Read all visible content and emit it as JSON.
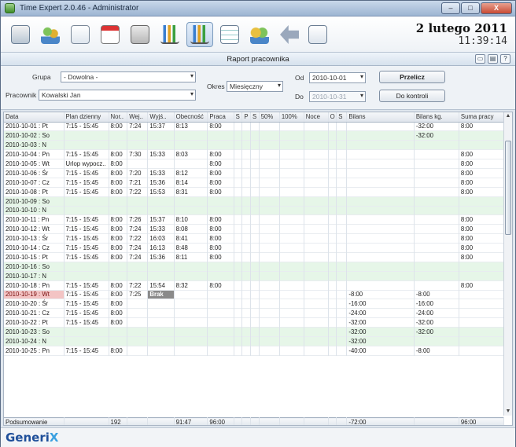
{
  "window": {
    "title": "Time Expert 2.0.46 - Administrator",
    "minimize": "–",
    "maximize": "□",
    "close": "X"
  },
  "clock": {
    "date": "2 lutego 2011",
    "time": "11:39:14"
  },
  "report": {
    "title": "Raport pracownika"
  },
  "filters": {
    "group_label": "Grupa",
    "group_value": "- Dowolna -",
    "employee_label": "Pracownik",
    "employee_value": "Kowalski Jan",
    "period_label": "Okres",
    "period_value": "Miesięczny",
    "from_label": "Od",
    "from_value": "2010-10-01",
    "to_label": "Do",
    "to_value": "2010-10-31",
    "show_button": "Przelicz",
    "contacts_button": "Do kontroli"
  },
  "table": {
    "columns": [
      "Data",
      "Plan dzienny",
      "Nor..",
      "Wej..",
      "Wyjś..",
      "Obecność",
      "Praca",
      "S",
      "P",
      "S",
      "50%",
      "100%",
      "Noce",
      "O",
      "S",
      "Bilans",
      "Bilans kg.",
      "Suma pracy"
    ],
    "rows": [
      {
        "c": [
          "2010-10-01 : Pt",
          "7:15 - 15:45",
          "8:00",
          "7:24",
          "15:37",
          "8:13",
          "8:00",
          "",
          "",
          "",
          "",
          "",
          "",
          "",
          "",
          "",
          "-32:00",
          "8:00"
        ],
        "t": ""
      },
      {
        "c": [
          "2010-10-02 : So",
          "",
          "",
          "",
          "",
          "",
          "",
          "",
          "",
          "",
          "",
          "",
          "",
          "",
          "",
          "",
          "-32:00",
          ""
        ],
        "t": "weekend"
      },
      {
        "c": [
          "2010-10-03 : N",
          "",
          "",
          "",
          "",
          "",
          "",
          "",
          "",
          "",
          "",
          "",
          "",
          "",
          "",
          "",
          "",
          ""
        ],
        "t": "weekend"
      },
      {
        "c": [
          "2010-10-04 : Pn",
          "7:15 - 15:45",
          "8:00",
          "7:30",
          "15:33",
          "8:03",
          "8:00",
          "",
          "",
          "",
          "",
          "",
          "",
          "",
          "",
          "",
          "",
          "8:00"
        ],
        "t": ""
      },
      {
        "c": [
          "2010-10-05 : Wt",
          "Urlop wypocz..",
          "8:00",
          "",
          "",
          "",
          "8:00",
          "",
          "",
          "",
          "",
          "",
          "",
          "",
          "",
          "",
          "",
          "8:00"
        ],
        "t": ""
      },
      {
        "c": [
          "2010-10-06 : Śr",
          "7:15 - 15:45",
          "8:00",
          "7:20",
          "15:33",
          "8:12",
          "8:00",
          "",
          "",
          "",
          "",
          "",
          "",
          "",
          "",
          "",
          "",
          "8:00"
        ],
        "t": ""
      },
      {
        "c": [
          "2010-10-07 : Cz",
          "7:15 - 15:45",
          "8:00",
          "7:21",
          "15:36",
          "8:14",
          "8:00",
          "",
          "",
          "",
          "",
          "",
          "",
          "",
          "",
          "",
          "",
          "8:00"
        ],
        "t": ""
      },
      {
        "c": [
          "2010-10-08 : Pt",
          "7:15 - 15:45",
          "8:00",
          "7:22",
          "15:53",
          "8:31",
          "8:00",
          "",
          "",
          "",
          "",
          "",
          "",
          "",
          "",
          "",
          "",
          "8:00"
        ],
        "t": ""
      },
      {
        "c": [
          "2010-10-09 : So",
          "",
          "",
          "",
          "",
          "",
          "",
          "",
          "",
          "",
          "",
          "",
          "",
          "",
          "",
          "",
          "",
          ""
        ],
        "t": "weekend"
      },
      {
        "c": [
          "2010-10-10 : N",
          "",
          "",
          "",
          "",
          "",
          "",
          "",
          "",
          "",
          "",
          "",
          "",
          "",
          "",
          "",
          "",
          ""
        ],
        "t": "weekend"
      },
      {
        "c": [
          "2010-10-11 : Pn",
          "7:15 - 15:45",
          "8:00",
          "7:26",
          "15:37",
          "8:10",
          "8:00",
          "",
          "",
          "",
          "",
          "",
          "",
          "",
          "",
          "",
          "",
          "8:00"
        ],
        "t": ""
      },
      {
        "c": [
          "2010-10-12 : Wt",
          "7:15 - 15:45",
          "8:00",
          "7:24",
          "15:33",
          "8:08",
          "8:00",
          "",
          "",
          "",
          "",
          "",
          "",
          "",
          "",
          "",
          "",
          "8:00"
        ],
        "t": ""
      },
      {
        "c": [
          "2010-10-13 : Śr",
          "7:15 - 15:45",
          "8:00",
          "7:22",
          "16:03",
          "8:41",
          "8:00",
          "",
          "",
          "",
          "",
          "",
          "",
          "",
          "",
          "",
          "",
          "8:00"
        ],
        "t": ""
      },
      {
        "c": [
          "2010-10-14 : Cz",
          "7:15 - 15:45",
          "8:00",
          "7:24",
          "16:13",
          "8:48",
          "8:00",
          "",
          "",
          "",
          "",
          "",
          "",
          "",
          "",
          "",
          "",
          "8:00"
        ],
        "t": ""
      },
      {
        "c": [
          "2010-10-15 : Pt",
          "7:15 - 15:45",
          "8:00",
          "7:24",
          "15:36",
          "8:11",
          "8:00",
          "",
          "",
          "",
          "",
          "",
          "",
          "",
          "",
          "",
          "",
          "8:00"
        ],
        "t": ""
      },
      {
        "c": [
          "2010-10-16 : So",
          "",
          "",
          "",
          "",
          "",
          "",
          "",
          "",
          "",
          "",
          "",
          "",
          "",
          "",
          "",
          "",
          ""
        ],
        "t": "weekend"
      },
      {
        "c": [
          "2010-10-17 : N",
          "",
          "",
          "",
          "",
          "",
          "",
          "",
          "",
          "",
          "",
          "",
          "",
          "",
          "",
          "",
          "",
          ""
        ],
        "t": "weekend"
      },
      {
        "c": [
          "2010-10-18 : Pn",
          "7:15 - 15:45",
          "8:00",
          "7:22",
          "15:54",
          "8:32",
          "8:00",
          "",
          "",
          "",
          "",
          "",
          "",
          "",
          "",
          "",
          "",
          "8:00"
        ],
        "t": ""
      },
      {
        "c": [
          "2010-10-19 : Wt",
          "7:15 - 15:45",
          "8:00",
          "7:25",
          "Brak",
          "",
          "",
          "",
          "",
          "",
          "",
          "",
          "",
          "",
          "",
          "-8:00",
          "-8:00",
          ""
        ],
        "t": "selected",
        "hl": 4
      },
      {
        "c": [
          "2010-10-20 : Śr",
          "7:15 - 15:45",
          "8:00",
          "",
          "",
          "",
          "",
          "",
          "",
          "",
          "",
          "",
          "",
          "",
          "",
          "-16:00",
          "-16:00",
          ""
        ],
        "t": ""
      },
      {
        "c": [
          "2010-10-21 : Cz",
          "7:15 - 15:45",
          "8:00",
          "",
          "",
          "",
          "",
          "",
          "",
          "",
          "",
          "",
          "",
          "",
          "",
          "-24:00",
          "-24:00",
          ""
        ],
        "t": ""
      },
      {
        "c": [
          "2010-10-22 : Pt",
          "7:15 - 15:45",
          "8:00",
          "",
          "",
          "",
          "",
          "",
          "",
          "",
          "",
          "",
          "",
          "",
          "",
          "-32:00",
          "-32:00",
          ""
        ],
        "t": ""
      },
      {
        "c": [
          "2010-10-23 : So",
          "",
          "",
          "",
          "",
          "",
          "",
          "",
          "",
          "",
          "",
          "",
          "",
          "",
          "",
          "-32:00",
          "-32:00",
          ""
        ],
        "t": "weekend"
      },
      {
        "c": [
          "2010-10-24 : N",
          "",
          "",
          "",
          "",
          "",
          "",
          "",
          "",
          "",
          "",
          "",
          "",
          "",
          "",
          "-32:00",
          "",
          ""
        ],
        "t": "weekend"
      },
      {
        "c": [
          "2010-10-25 : Pn",
          "7:15 - 15:45",
          "8:00",
          "",
          "",
          "",
          "",
          "",
          "",
          "",
          "",
          "",
          "",
          "",
          "",
          "-40:00",
          "-8:00",
          ""
        ],
        "t": ""
      }
    ],
    "summary": [
      "Podsumowanie",
      "",
      "192",
      "",
      "",
      "91:47",
      "96:00",
      "",
      "",
      "",
      "",
      "",
      "",
      "",
      "",
      "-72:00",
      "",
      "96:00"
    ]
  },
  "footer": {
    "logo_main": "Generi",
    "logo_x": "X"
  }
}
